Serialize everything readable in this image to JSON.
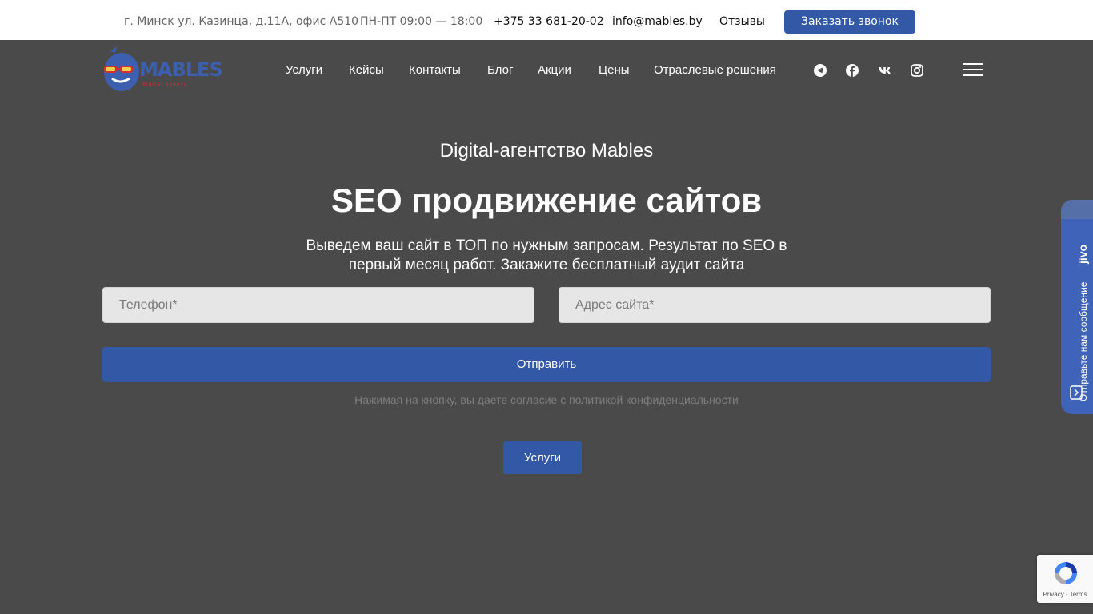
{
  "topbar": {
    "address": "г. Минск ул. Казинца, д.11А, офис А510",
    "hours": "ПН-ПТ 09:00 — 18:00",
    "phone": "+375 33 681-20-02",
    "email": "info@mables.by",
    "reviews": "Отзывы",
    "callback_button": "Заказать звонок"
  },
  "header": {
    "logo_text": "MABLES",
    "logo_subtext": "digital agency",
    "nav": [
      "Услуги",
      "Кейсы",
      "Контакты",
      "Блог",
      "Акции",
      "Цены",
      "Отраслевые решения"
    ],
    "social_icons": [
      "telegram-icon",
      "facebook-icon",
      "vk-icon",
      "instagram-icon"
    ],
    "menu_icon": "hamburger-menu-icon"
  },
  "hero": {
    "subtitle": "Digital-агентство Mables",
    "title": "SEO продвижение сайтов",
    "text": "Выведем ваш сайт в ТОП по нужным запросам. Результат по SEO в первый месяц работ. Закажите бесплатный аудит сайта"
  },
  "form": {
    "phone_placeholder": "Телефон*",
    "site_placeholder": "Адрес сайта*",
    "submit_label": "Отправить",
    "consent_prefix": "Нажимая на кнопку, вы даете согласие с ",
    "consent_link": "политикой конфиденциальности"
  },
  "services_button": "Услуги",
  "jivo": {
    "text": "Отправьте нам сообщение",
    "brand": "jivo"
  },
  "recaptcha": {
    "links": "Privacy - Terms"
  },
  "colors": {
    "accent": "#3358a6",
    "background": "#4a4a4a",
    "topbar": "#ffffff",
    "logo_blue": "#3d5fb0",
    "logo_red": "#d0302f"
  }
}
